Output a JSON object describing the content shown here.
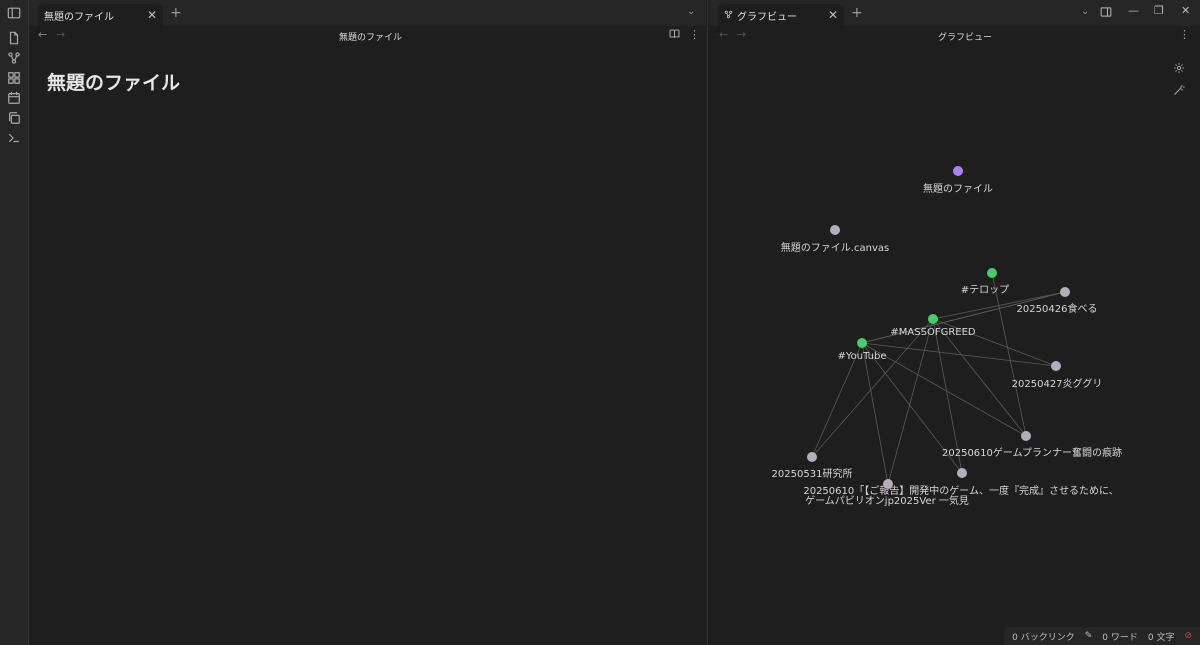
{
  "left_pane": {
    "tab_label": "無題のファイル",
    "nav_title": "無題のファイル",
    "doc_title": "無題のファイル"
  },
  "right_pane": {
    "tab_label": "グラフビュー",
    "nav_title": "グラフビュー"
  },
  "graph": {
    "node_colors": {
      "file": "#b3aebb",
      "tag": "#4cc96a",
      "active": "#a882ff"
    },
    "nodes": [
      {
        "id": "n0",
        "label": "無題のファイル",
        "kind": "active"
      },
      {
        "id": "n1",
        "label": "無題のファイル.canvas",
        "kind": "file"
      },
      {
        "id": "n2",
        "label": "#テロップ",
        "kind": "tag"
      },
      {
        "id": "n3",
        "label": "20250426食べる",
        "kind": "file"
      },
      {
        "id": "n4",
        "label": "#MASSOFGREED",
        "kind": "tag"
      },
      {
        "id": "n5",
        "label": "#YouTube",
        "kind": "tag"
      },
      {
        "id": "n6",
        "label": "20250427炎ググリ",
        "kind": "file"
      },
      {
        "id": "n7",
        "label": "20250610ゲームプランナー奮闘の痕跡",
        "kind": "file"
      },
      {
        "id": "n8",
        "label": "20250531研究所",
        "kind": "file"
      },
      {
        "id": "n9",
        "label": "20250610「【ご報告】開発中のゲーム、一度『完成』させるために、",
        "kind": "file"
      },
      {
        "id": "n10",
        "label": "ゲームパビリオンjp2025Ver 一気見",
        "kind": "file"
      }
    ],
    "edges": [
      [
        "n4",
        "n3"
      ],
      [
        "n4",
        "n6"
      ],
      [
        "n4",
        "n7"
      ],
      [
        "n4",
        "n8"
      ],
      [
        "n4",
        "n9"
      ],
      [
        "n4",
        "n10"
      ],
      [
        "n5",
        "n3"
      ],
      [
        "n5",
        "n6"
      ],
      [
        "n5",
        "n7"
      ],
      [
        "n5",
        "n8"
      ],
      [
        "n5",
        "n9"
      ],
      [
        "n5",
        "n10"
      ],
      [
        "n2",
        "n7"
      ],
      [
        "n3",
        "n5"
      ]
    ]
  },
  "status_bar": {
    "backlinks": "0 バックリンク",
    "words": "0 ワード",
    "chars": "0 文字"
  },
  "icons": [
    "sidebar-toggle-icon",
    "files-icon",
    "graph-icon",
    "blocks-icon",
    "calendar-icon",
    "copy-icon",
    "terminal-icon",
    "close-icon",
    "plus-icon",
    "chevron-down-icon",
    "back-arrow-icon",
    "forward-arrow-icon",
    "book-icon",
    "more-icon",
    "settings-icon",
    "wand-icon",
    "split-layout-icon",
    "minimize-icon",
    "restore-icon",
    "edit-icon",
    "sync-off-icon"
  ]
}
